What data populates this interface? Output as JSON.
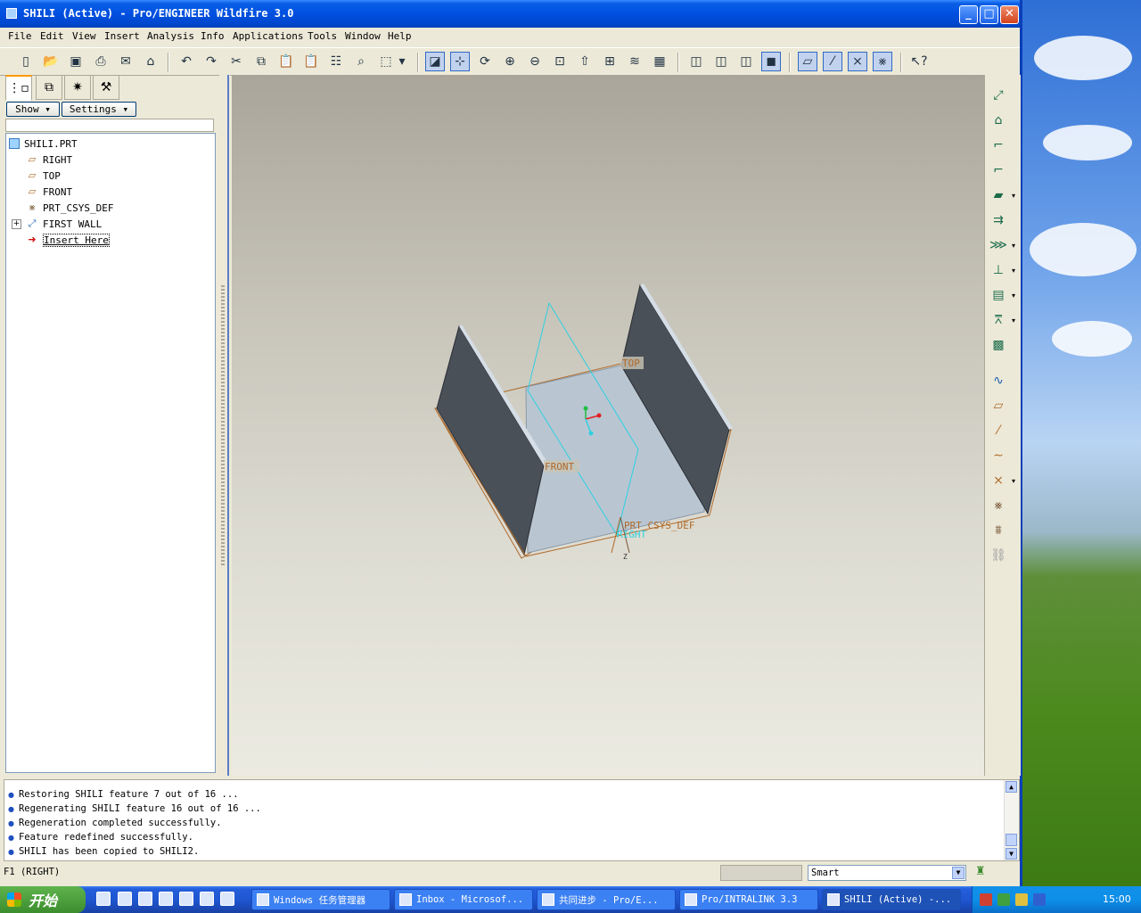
{
  "window": {
    "title": "SHILI (Active) - Pro/ENGINEER Wildfire 3.0",
    "minimize_label": "_",
    "maximize_label": "□",
    "close_label": "✕"
  },
  "menu": [
    {
      "label": "File"
    },
    {
      "label": "Edit"
    },
    {
      "label": "View"
    },
    {
      "label": "Insert"
    },
    {
      "label": "Analysis"
    },
    {
      "label": "Info"
    },
    {
      "label": "Applications"
    },
    {
      "label": "Tools"
    },
    {
      "label": "Window"
    },
    {
      "label": "Help"
    }
  ],
  "left_panel": {
    "show_label": "Show ▾",
    "settings_label": "Settings ▾",
    "tree": [
      {
        "label": "SHILI.PRT",
        "icon": "part-icon"
      },
      {
        "label": "RIGHT",
        "icon": "datum-plane-icon"
      },
      {
        "label": "TOP",
        "icon": "datum-plane-icon"
      },
      {
        "label": "FRONT",
        "icon": "datum-plane-icon"
      },
      {
        "label": "PRT_CSYS_DEF",
        "icon": "csys-icon"
      },
      {
        "label": "FIRST WALL",
        "icon": "sheetmetal-wall-icon",
        "expand": "+"
      },
      {
        "label": "Insert Here",
        "icon": "insert-arrow-icon"
      }
    ]
  },
  "graphics": {
    "labels": {
      "top": "TOP",
      "front": "FRONT",
      "csys": "PRT_CSYS_DEF",
      "right": "RIGHT",
      "z": "Z"
    },
    "colors": {
      "wall_dark": "#4a5058",
      "base_face": "#b9c6d2",
      "datum_orange": "#b06a2a",
      "datum_cyan": "#2fd0e0"
    }
  },
  "messages": [
    "Restoring SHILI feature 7 out of 16 ...",
    "Regenerating SHILI feature 16 out of 16 ...",
    "Regeneration completed successfully.",
    "Feature redefined successfully.",
    "SHILI has been copied to SHILI2."
  ],
  "statusbar": {
    "left_text": "F1 (RIGHT)",
    "filter_value": "Smart"
  },
  "taskbar": {
    "start_label": "开始",
    "tasks": [
      {
        "label": "Windows 任务管理器"
      },
      {
        "label": "Inbox - Microsof..."
      },
      {
        "label": "共同进步 - Pro/E..."
      },
      {
        "label": "Pro/INTRALINK 3.3"
      },
      {
        "label": "SHILI (Active) -..."
      }
    ],
    "clock": "15:00"
  }
}
